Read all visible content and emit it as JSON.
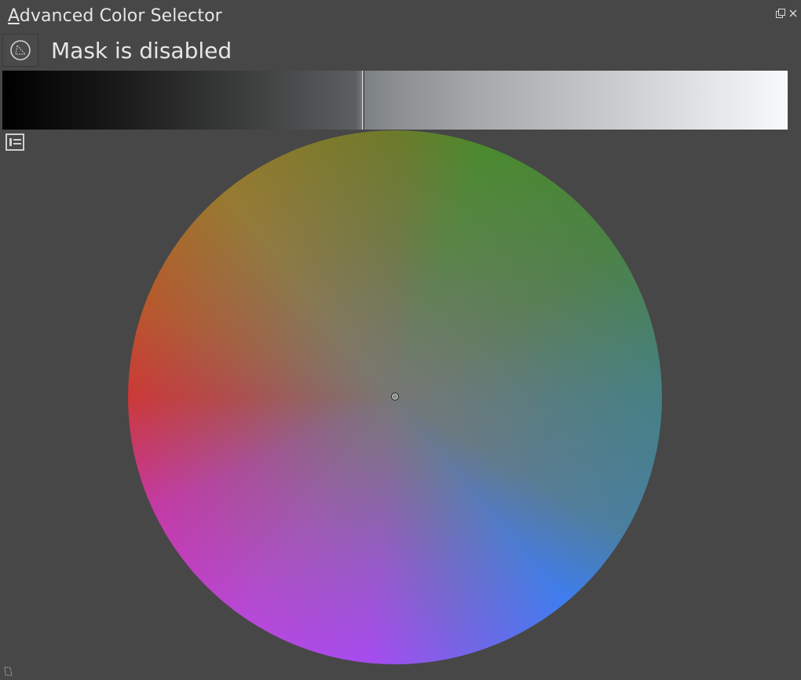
{
  "window": {
    "title_mnemonic": "A",
    "title_rest": "dvanced Color Selector",
    "float_icon": "float-icon",
    "close_icon": "close-icon"
  },
  "mask": {
    "button_icon": "mask-brush-icon",
    "label": "Mask is disabled"
  },
  "value_slider": {
    "value": 0.46
  },
  "settings": {
    "icon": "settings-list-icon"
  },
  "color_wheel": {
    "type": "hue-saturation-wheel",
    "selected_hue_deg": 0,
    "selected_saturation": 0.0
  },
  "colors": {
    "background": "#474747",
    "text": "#e6e6e6"
  }
}
